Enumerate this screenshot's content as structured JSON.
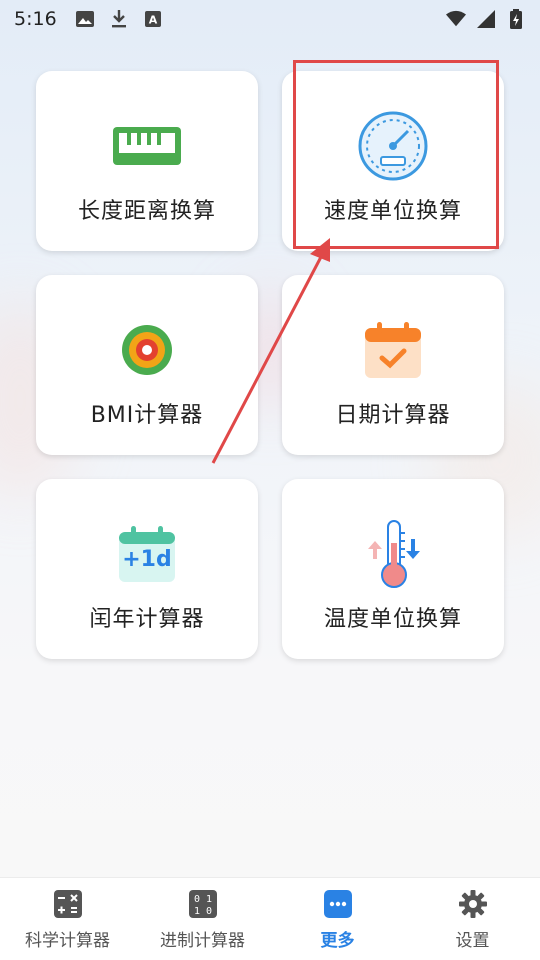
{
  "status_bar": {
    "time": "5:16",
    "icons_left": [
      "image-icon",
      "download-icon",
      "a-text-icon"
    ],
    "icons_right": [
      "wifi-icon",
      "signal-icon",
      "battery-icon"
    ]
  },
  "grid": {
    "cards": [
      {
        "label": "长度距离换算",
        "icon": "ruler-icon"
      },
      {
        "label": "速度单位换算",
        "icon": "speedometer-icon"
      },
      {
        "label": "BMI计算器",
        "icon": "target-icon"
      },
      {
        "label": "日期计算器",
        "icon": "calendar-check-icon"
      },
      {
        "label": "闰年计算器",
        "icon": "calendar-plus-one-icon",
        "icon_text": "+1d"
      },
      {
        "label": "温度单位换算",
        "icon": "thermometer-icon"
      }
    ]
  },
  "annotation": {
    "highlight_color": "#e04848"
  },
  "bottom_nav": {
    "items": [
      {
        "label": "科学计算器",
        "icon": "calculator-icon"
      },
      {
        "label": "进制计算器",
        "icon": "binary-icon",
        "icon_text": "0 1\n1 0"
      },
      {
        "label": "更多",
        "icon": "more-dots-icon",
        "active": true
      },
      {
        "label": "设置",
        "icon": "gear-icon"
      }
    ]
  },
  "colors": {
    "accent": "#2a82e4",
    "nav_icon": "#555555"
  }
}
